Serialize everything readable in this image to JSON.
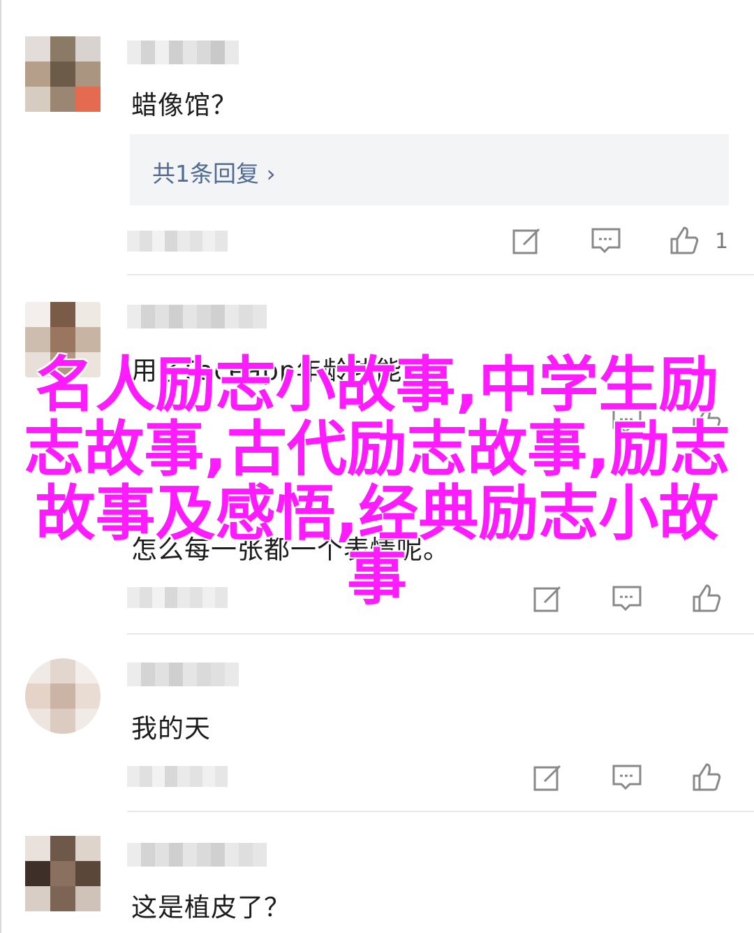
{
  "comments": [
    {
      "text": "蜡像馆？",
      "reply_label": "共1条回复 ›",
      "like_count": "1"
    },
    {
      "text": "用了Faceapp年龄功能🐶",
      "text2": "怎么每一张都一个表情呢。"
    },
    {
      "text": "我的天"
    },
    {
      "text": "这是植皮了？"
    }
  ],
  "overlay": {
    "title": "名人励志小故事,中学生励志故事,古代励志故事,励志故事及感悟,经典励志小故事"
  },
  "icons": {
    "edit": "edit-icon",
    "comment": "comment-icon",
    "like": "thumbs-up-icon"
  }
}
